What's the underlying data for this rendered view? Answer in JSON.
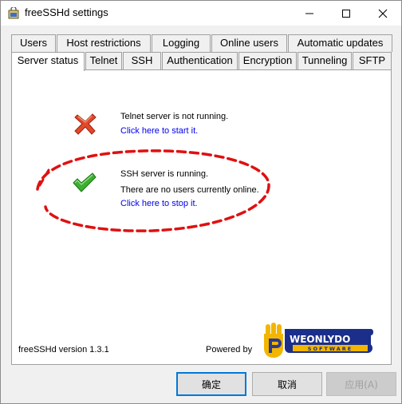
{
  "window": {
    "title": "freeSSHd settings"
  },
  "tabs": {
    "row1": [
      "Users",
      "Host restrictions",
      "Logging",
      "Online users",
      "Automatic updates"
    ],
    "row2": [
      "Server status",
      "Telnet",
      "SSH",
      "Authentication",
      "Encryption",
      "Tunneling",
      "SFTP"
    ],
    "active": "Server status"
  },
  "status": {
    "telnet": {
      "message": "Telnet server is not running.",
      "link": "Click here to start it.",
      "icon": "red-x-icon"
    },
    "ssh": {
      "message": "SSH server is running.",
      "detail": "There are no users currently online.",
      "link": "Click here to stop it.",
      "icon": "green-check-icon"
    }
  },
  "footer": {
    "version": "freeSSHd version 1.3.1",
    "powered_by": "Powered by",
    "logo": {
      "name": "WEONLYDO",
      "sub": "SOFTWARE"
    }
  },
  "buttons": {
    "ok": "确定",
    "cancel": "取消",
    "apply": "应用(A)"
  },
  "colors": {
    "accent": "#0078d7",
    "link": "#0000ee",
    "annotation": "#e01010"
  }
}
